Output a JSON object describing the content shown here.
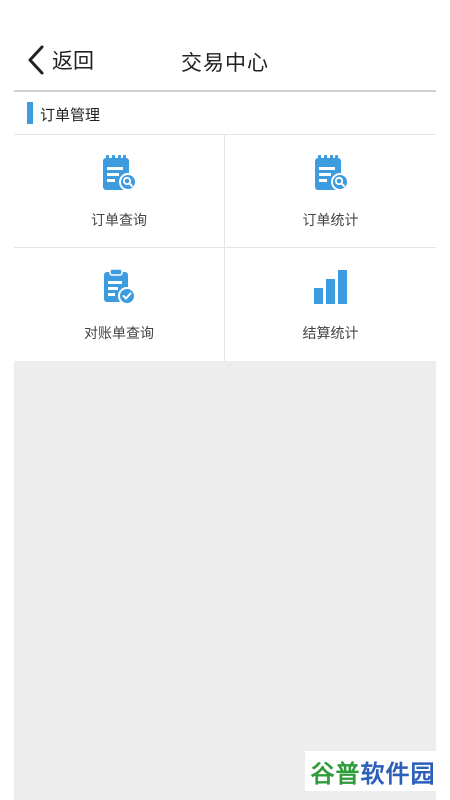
{
  "header": {
    "back_label": "返回",
    "title": "交易中心"
  },
  "section": {
    "title": "订单管理"
  },
  "tiles": [
    {
      "label": "订单查询",
      "icon": "order-search-icon"
    },
    {
      "label": "订单统计",
      "icon": "order-stats-icon"
    },
    {
      "label": "对账单查询",
      "icon": "statement-check-icon"
    },
    {
      "label": "结算统计",
      "icon": "bar-chart-icon"
    }
  ],
  "watermark": {
    "part1": "谷普",
    "part2": "软件园"
  },
  "colors": {
    "accent": "#3d9be0",
    "background": "#ededed",
    "watermark_green": "#2e9c3a",
    "watermark_blue": "#2b5fb8"
  }
}
